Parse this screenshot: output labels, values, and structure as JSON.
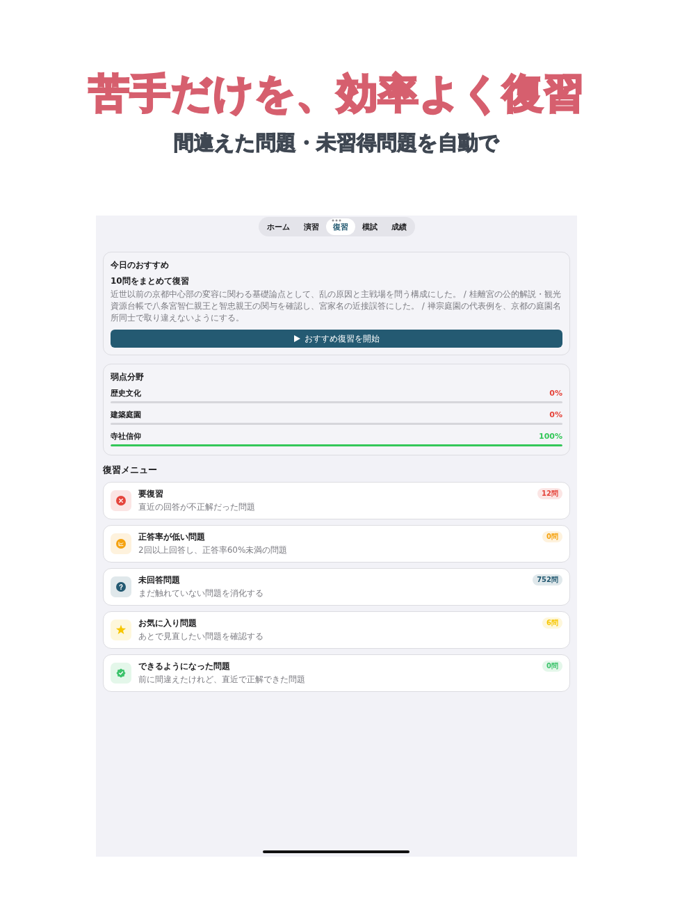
{
  "headline": {
    "title": "苦手だけを、効率よく復習",
    "subtitle": "間違えた問題・未習得問題を自動で"
  },
  "tabs": [
    {
      "label": "ホーム",
      "selected": false
    },
    {
      "label": "演習",
      "selected": false
    },
    {
      "label": "復習",
      "selected": true
    },
    {
      "label": "模試",
      "selected": false
    },
    {
      "label": "成績",
      "selected": false
    }
  ],
  "recommendation": {
    "heading": "今日のおすすめ",
    "title": "10問をまとめて復習",
    "description": "近世以前の京都中心部の変容に関わる基礎論点として、乱の原因と主戦場を問う構成にした。 / 桂離宮の公的解説・観光資源台帳で八条宮智仁親王と智忠親王の関与を確認し、宮家名の近接誤答にした。 / 禅宗庭園の代表例を、京都の庭園名所同士で取り違えないようにする。",
    "button_label": "おすすめ復習を開始"
  },
  "weak_areas": {
    "heading": "弱点分野",
    "items": [
      {
        "name": "歴史文化",
        "reading": "0%",
        "level": 0
      },
      {
        "name": "建築庭園",
        "reading": "0%",
        "level": 0
      },
      {
        "name": "寺社信仰",
        "reading": "100%",
        "level": 1
      }
    ]
  },
  "review_menu": {
    "heading": "復習メニュー",
    "items": [
      {
        "kind": "cross",
        "title": "要復習",
        "subtitle": "直近の回答が不正解だった問題",
        "count": "12問",
        "color": "#e5453c"
      },
      {
        "kind": "chart",
        "title": "正答率が低い問題",
        "subtitle": "2回以上回答し、正答率60%未満の問題",
        "count": "0問",
        "color": "#f5a20f"
      },
      {
        "kind": "question",
        "title": "未回答問題",
        "subtitle": "まだ触れていない問題を消化する",
        "count": "752問",
        "color": "#245a72"
      },
      {
        "kind": "star",
        "title": "お気に入り問題",
        "subtitle": "あとで見直したい問題を確認する",
        "count": "6問",
        "color": "#f7c600"
      },
      {
        "kind": "check",
        "title": "できるようになった問題",
        "subtitle": "前に間違えたけれど、直近で正解できた問題",
        "count": "0問",
        "color": "#3cc36b"
      }
    ]
  }
}
